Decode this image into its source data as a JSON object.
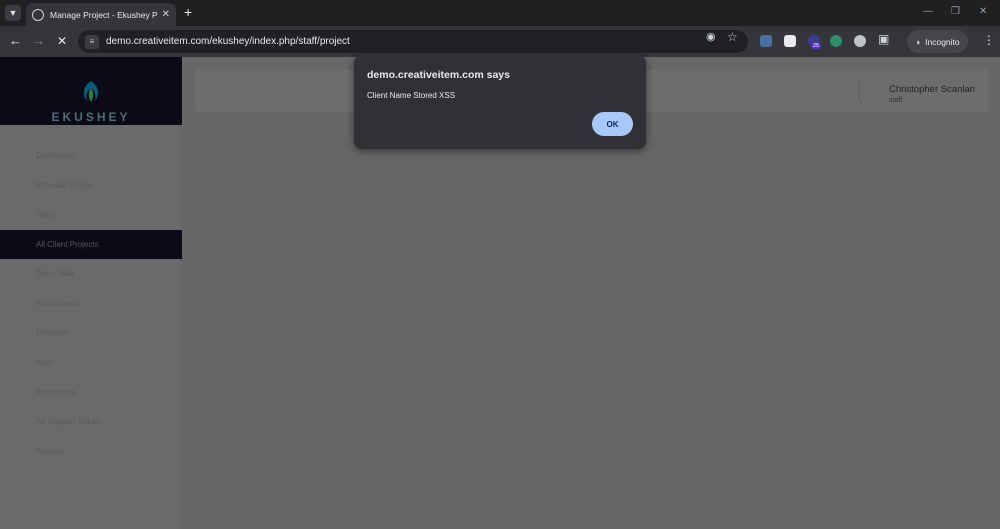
{
  "browser": {
    "tab_title": "Manage Project - Ekushey Proje",
    "url": "demo.creativeitem.com/ekushey/index.php/staff/project",
    "profile_label": "Incognito",
    "extension_badge": "25"
  },
  "app": {
    "logo_text": "EKUSHEY",
    "nav_items": [
      {
        "label": "Dashboard"
      },
      {
        "label": "Potential Artists"
      },
      {
        "label": "Team"
      },
      {
        "label": "All Client Projects"
      },
      {
        "label": "Team Task"
      },
      {
        "label": "Noticeboard"
      },
      {
        "label": "Message"
      },
      {
        "label": "Note"
      },
      {
        "label": "Accounting"
      },
      {
        "label": "All Support Tickets"
      },
      {
        "label": "Account"
      }
    ],
    "active_nav": "All Client Projects",
    "user": {
      "name": "Christopher Scanlan",
      "role": "staff"
    }
  },
  "dialog": {
    "origin": "demo.creativeitem.com says",
    "message": "Client Name Stored XSS",
    "ok_label": "OK",
    "button_color": "#a8c7fa"
  }
}
